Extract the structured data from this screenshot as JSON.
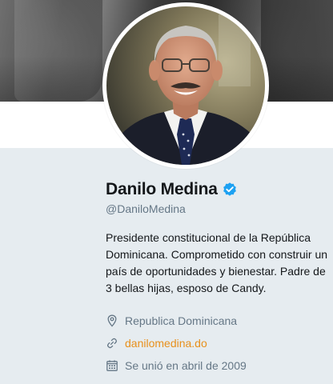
{
  "profile": {
    "name": "Danilo Medina",
    "handle": "@DaniloMedina",
    "bio": "Presidente constitucional de la República Dominicana. Comprometido con construir un país de oportunidades y bienestar. Padre de 3 bellas hijas, esposo de Candy.",
    "location": "Republica Dominicana",
    "website": "danilomedina.do",
    "joined": "Se unió en abril de 2009"
  },
  "icons": {
    "verified": "verified-badge-icon",
    "location": "map-pin-icon",
    "website": "link-icon",
    "joined": "calendar-icon"
  },
  "colors": {
    "background": "#e6ecf0",
    "verified": "#1da1f2",
    "link": "#e8901c",
    "muted": "#657786"
  }
}
